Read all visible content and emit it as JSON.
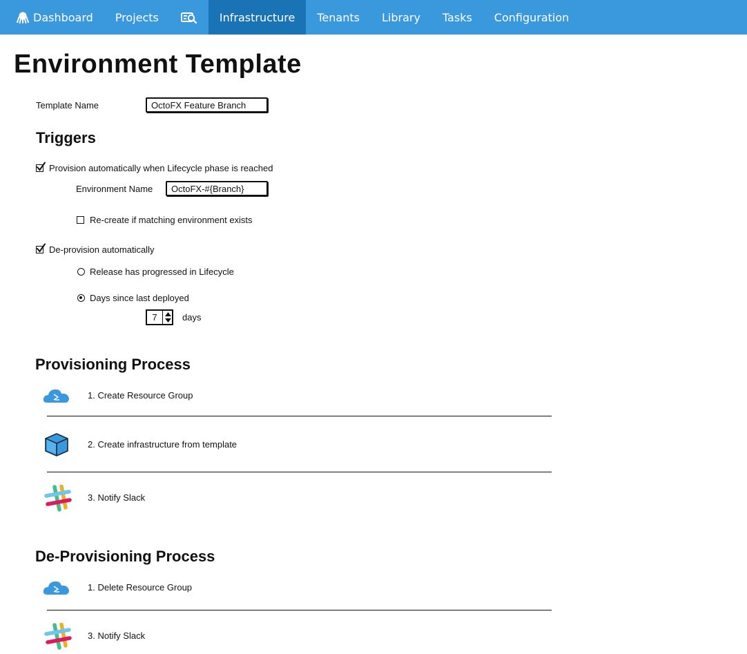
{
  "nav": {
    "items": [
      {
        "label": "Dashboard",
        "icon": "octopus-icon"
      },
      {
        "label": "Projects"
      },
      {
        "label": "",
        "icon": "search-library-icon"
      },
      {
        "label": "Infrastructure",
        "active": true
      },
      {
        "label": "Tenants"
      },
      {
        "label": "Library"
      },
      {
        "label": "Tasks"
      },
      {
        "label": "Configuration"
      }
    ],
    "background": "#3a98dd",
    "active_background": "#1a73b5"
  },
  "page": {
    "title": "Environment Template",
    "template_name_label": "Template Name",
    "template_name_value": "OctoFX Feature Branch"
  },
  "triggers": {
    "title": "Triggers",
    "provision_auto": {
      "label": "Provision automatically when Lifecycle phase is reached",
      "checked": true
    },
    "environment_name_label": "Environment Name",
    "environment_name_value": "OctoFX-#{Branch}",
    "recreate": {
      "label": "Re-create if matching environment exists",
      "checked": false
    },
    "deprovision_auto": {
      "label": "De-provision automatically",
      "checked": true
    },
    "release_progressed": {
      "label": "Release has progressed in Lifecycle",
      "selected": false
    },
    "days_since": {
      "label": "Days since last deployed",
      "selected": true
    },
    "days_value": "7",
    "days_unit": "days"
  },
  "provisioning": {
    "title": "Provisioning Process",
    "steps": [
      {
        "label": "1. Create Resource Group",
        "icon": "azure-cloud-icon"
      },
      {
        "label": "2. Create infrastructure from template",
        "icon": "azure-cube-icon"
      },
      {
        "label": "3. Notify Slack",
        "icon": "slack-icon"
      }
    ]
  },
  "deprovisioning": {
    "title": "De-Provisioning Process",
    "steps": [
      {
        "label": "1. Delete Resource Group",
        "icon": "azure-cloud-icon"
      },
      {
        "label": "3. Notify Slack",
        "icon": "slack-icon"
      }
    ]
  }
}
